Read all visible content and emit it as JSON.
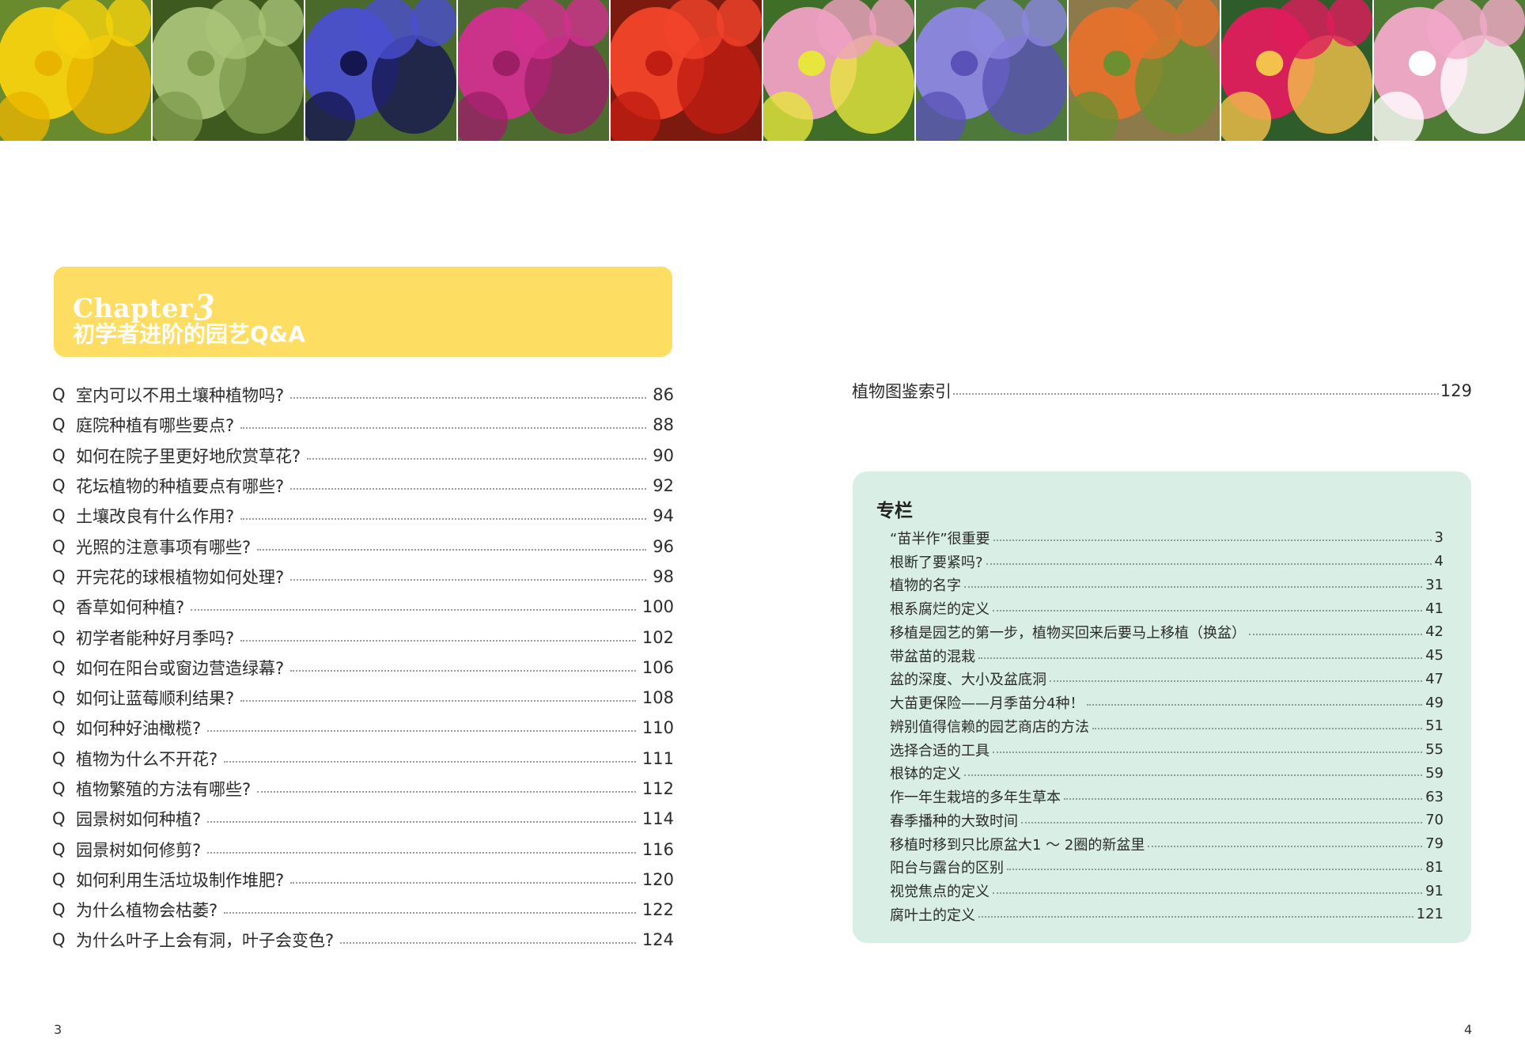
{
  "photos": [
    {
      "name": "crocus-photo",
      "bg": "#6a8a2e",
      "flower": "#f5d20d",
      "accent": "#e8b400"
    },
    {
      "name": "balloon-vine-photo",
      "bg": "#3f5a1e",
      "flower": "#a9c477",
      "accent": "#7f9c4d"
    },
    {
      "name": "anemone-photo",
      "bg": "#4a6a2c",
      "flower": "#4a4fcf",
      "accent": "#151650"
    },
    {
      "name": "celosia-photo",
      "bg": "#4e6b2f",
      "flower": "#d2308f",
      "accent": "#9c1f66"
    },
    {
      "name": "amaryllis-photo",
      "bg": "#7c1a10",
      "flower": "#f1442a",
      "accent": "#c11d12"
    },
    {
      "name": "daisy-photo",
      "bg": "#3f6e28",
      "flower": "#f0a0c2",
      "accent": "#e6e63c"
    },
    {
      "name": "balloon-flower-photo",
      "bg": "#4d7a3a",
      "flower": "#8c86e0",
      "accent": "#5a52b6"
    },
    {
      "name": "succulent-photo",
      "bg": "#8d7a4a",
      "flower": "#e5722c",
      "accent": "#6c8f2f"
    },
    {
      "name": "peony-photo",
      "bg": "#2f5c2b",
      "flower": "#e01c5c",
      "accent": "#f3c24b"
    },
    {
      "name": "primula-photo",
      "bg": "#4f7c34",
      "flower": "#f3a9c9",
      "accent": "#ffffff"
    }
  ],
  "chapter": {
    "word": "Chapter",
    "number": "3",
    "title": "初学者进阶的园艺Q&A"
  },
  "toc": [
    {
      "q": "Q",
      "text": "室内可以不用土壤种植物吗?",
      "page": "86"
    },
    {
      "q": "Q",
      "text": "庭院种植有哪些要点?",
      "page": "88"
    },
    {
      "q": "Q",
      "text": "如何在院子里更好地欣赏草花?",
      "page": "90"
    },
    {
      "q": "Q",
      "text": "花坛植物的种植要点有哪些?",
      "page": "92"
    },
    {
      "q": "Q",
      "text": "土壤改良有什么作用?",
      "page": "94"
    },
    {
      "q": "Q",
      "text": "光照的注意事项有哪些?",
      "page": "96"
    },
    {
      "q": "Q",
      "text": "开完花的球根植物如何处理?",
      "page": "98"
    },
    {
      "q": "Q",
      "text": "香草如何种植?",
      "page": "100"
    },
    {
      "q": "Q",
      "text": "初学者能种好月季吗?",
      "page": "102"
    },
    {
      "q": "Q",
      "text": "如何在阳台或窗边营造绿幕?",
      "page": "106"
    },
    {
      "q": "Q",
      "text": "如何让蓝莓顺利结果?",
      "page": "108"
    },
    {
      "q": "Q",
      "text": "如何种好油橄榄?",
      "page": "110"
    },
    {
      "q": "Q",
      "text": "植物为什么不开花?",
      "page": "111"
    },
    {
      "q": "Q",
      "text": "植物繁殖的方法有哪些?",
      "page": "112"
    },
    {
      "q": "Q",
      "text": "园景树如何种植?",
      "page": "114"
    },
    {
      "q": "Q",
      "text": "园景树如何修剪?",
      "page": "116"
    },
    {
      "q": "Q",
      "text": "如何利用生活垃圾制作堆肥?",
      "page": "120"
    },
    {
      "q": "Q",
      "text": "为什么植物会枯萎?",
      "page": "122"
    },
    {
      "q": "Q",
      "text": "为什么叶子上会有洞，叶子会变色?",
      "page": "124"
    }
  ],
  "index": {
    "text": "植物图鉴索引",
    "page": "129"
  },
  "column": {
    "title": "专栏",
    "items": [
      {
        "text": "“苗半作”很重要",
        "page": "3"
      },
      {
        "text": "根断了要紧吗?",
        "page": "4"
      },
      {
        "text": "植物的名字",
        "page": "31"
      },
      {
        "text": "根系腐烂的定义",
        "page": "41"
      },
      {
        "text": "移植是园艺的第一步，植物买回来后要马上移植（换盆）",
        "page": "42"
      },
      {
        "text": "带盆苗的混栽",
        "page": "45"
      },
      {
        "text": "盆的深度、大小及盆底洞",
        "page": "47"
      },
      {
        "text": "大苗更保险——月季苗分4种！",
        "page": "49"
      },
      {
        "text": "辨别值得信赖的园艺商店的方法",
        "page": "51"
      },
      {
        "text": "选择合适的工具",
        "page": "55"
      },
      {
        "text": "根钵的定义",
        "page": "59"
      },
      {
        "text": "作一年生栽培的多年生草本",
        "page": "63"
      },
      {
        "text": "春季播种的大致时间",
        "page": "70"
      },
      {
        "text": "移植时移到只比原盆大1 ～ 2圈的新盆里",
        "page": "79"
      },
      {
        "text": "阳台与露台的区别",
        "page": "81"
      },
      {
        "text": "视觉焦点的定义",
        "page": "91"
      },
      {
        "text": "腐叶土的定义",
        "page": "121"
      }
    ]
  },
  "page_numbers": {
    "left": "3",
    "right": "4"
  }
}
